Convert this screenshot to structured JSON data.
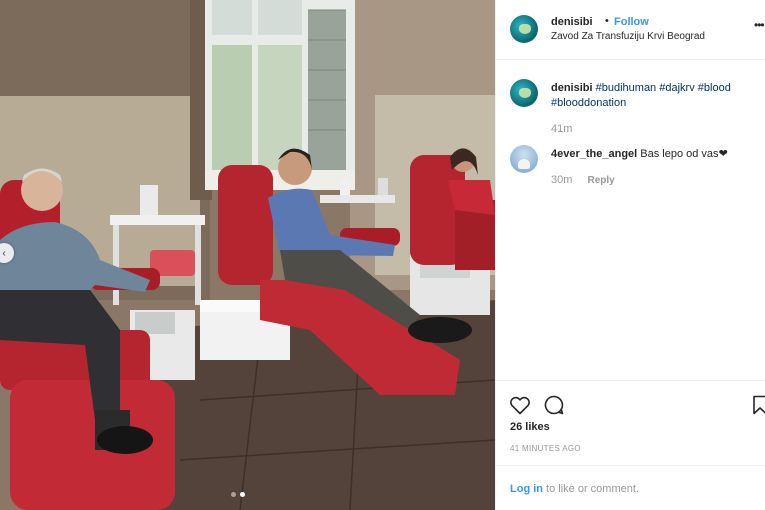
{
  "post": {
    "username": "denisibi",
    "separator": "•",
    "follow_label": "Follow",
    "location": "Zavod Za Transfuziju Krvi Beograd",
    "more_icon": "more-horizontal-icon"
  },
  "caption": {
    "username": "denisibi",
    "tags": [
      "#budihuman",
      "#dajkrv",
      "#blood",
      "#blooddonation"
    ],
    "time": "41m"
  },
  "comments": [
    {
      "username": "4ever_the_angel",
      "text": "Bas lepo od vas",
      "emoji": "❤",
      "time": "30m",
      "reply_label": "Reply"
    }
  ],
  "actions": {
    "like_icon": "heart-icon",
    "comment_icon": "comment-bubble-icon",
    "save_icon": "bookmark-icon",
    "likes": "26 likes",
    "posted_ago": "41 MINUTES AGO"
  },
  "footer": {
    "login_link": "Log in",
    "login_rest": " to like or comment."
  },
  "carousel": {
    "prev_icon": "chevron-left-icon",
    "slide_count": 2,
    "active_slide": 2
  },
  "colors": {
    "link_blue": "#3897f0",
    "hashtag": "#003569",
    "muted": "#999999",
    "border": "#efefef"
  }
}
